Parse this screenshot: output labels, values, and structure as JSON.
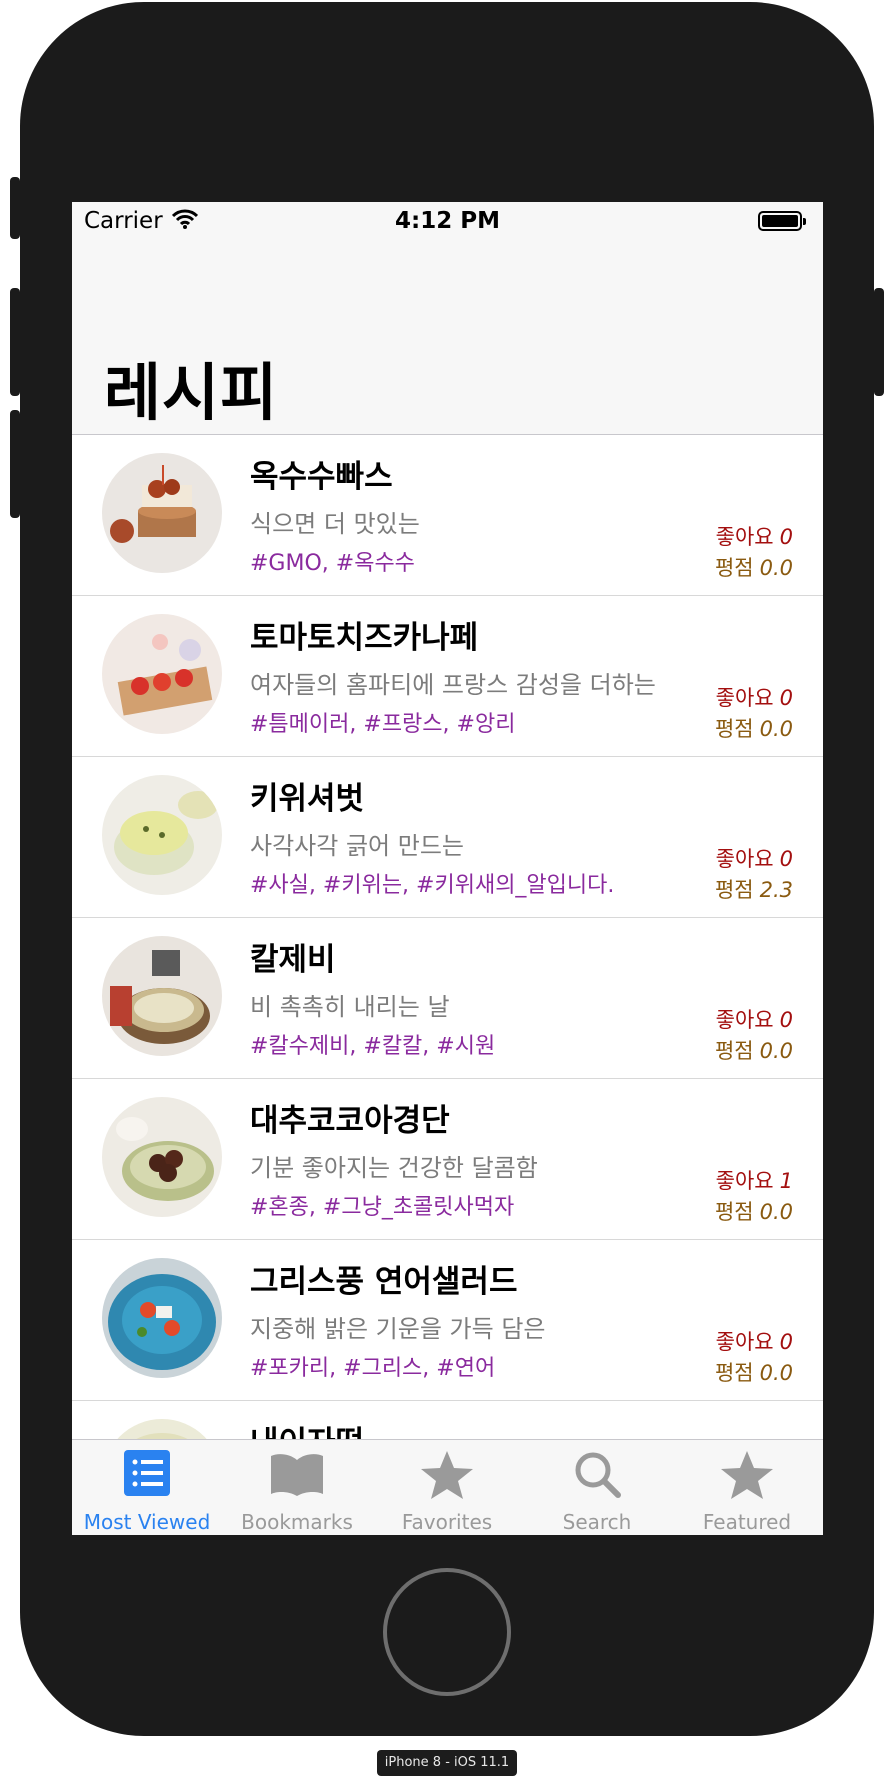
{
  "status_bar": {
    "carrier": "Carrier",
    "time": "4:12 PM"
  },
  "nav": {
    "title": "레시피"
  },
  "recipes": [
    {
      "name": "옥수수빠스",
      "description": "식으면 더 맛있는",
      "tags": "#GMO, #옥수수",
      "likes_label": "좋아요",
      "likes": "0",
      "rating_label": "평점",
      "rating": "0.0"
    },
    {
      "name": "토마토치즈카나페",
      "description": "여자들의 홈파티에 프랑스 감성을 더하는",
      "tags": "#틈메이러, #프랑스, #앙리",
      "likes_label": "좋아요",
      "likes": "0",
      "rating_label": "평점",
      "rating": "0.0"
    },
    {
      "name": "키위셔벗",
      "description": "사각사각 긁어 만드는",
      "tags": "#사실, #키위는, #키위새의_알입니다.",
      "likes_label": "좋아요",
      "likes": "0",
      "rating_label": "평점",
      "rating": "2.3"
    },
    {
      "name": "칼제비",
      "description": "비 촉촉히 내리는 날",
      "tags": "#칼수제비, #칼칼, #시원",
      "likes_label": "좋아요",
      "likes": "0",
      "rating_label": "평점",
      "rating": "0.0"
    },
    {
      "name": "대추코코아경단",
      "description": "기분 좋아지는 건강한 달콤함",
      "tags": "#혼종, #그냥_초콜릿사먹자",
      "likes_label": "좋아요",
      "likes": "1",
      "rating_label": "평점",
      "rating": "0.0"
    },
    {
      "name": "그리스풍 연어샐러드",
      "description": "지중해 밝은 기운을 가득 담은",
      "tags": "#포카리, #그리스, #연어",
      "likes_label": "좋아요",
      "likes": "0",
      "rating_label": "평점",
      "rating": "0.0"
    },
    {
      "name": "내이자떡",
      "description": "",
      "tags": "",
      "likes_label": "",
      "likes": "",
      "rating_label": "",
      "rating": ""
    }
  ],
  "tabs": [
    {
      "label": "Most Viewed",
      "icon": "list-icon",
      "active": true
    },
    {
      "label": "Bookmarks",
      "icon": "book-icon",
      "active": false
    },
    {
      "label": "Favorites",
      "icon": "star-icon",
      "active": false
    },
    {
      "label": "Search",
      "icon": "search-icon",
      "active": false
    },
    {
      "label": "Featured",
      "icon": "star-icon",
      "active": false
    }
  ],
  "device_label": "iPhone 8 - iOS 11.1",
  "colors": {
    "accent": "#2a82f0",
    "tag": "#8a2a9e",
    "likes": "#a30f0f",
    "rating": "#8a5a10",
    "description": "#7c7c7c",
    "inactive_tab": "#9a9a9a",
    "bezel": "#1b1b1b"
  }
}
